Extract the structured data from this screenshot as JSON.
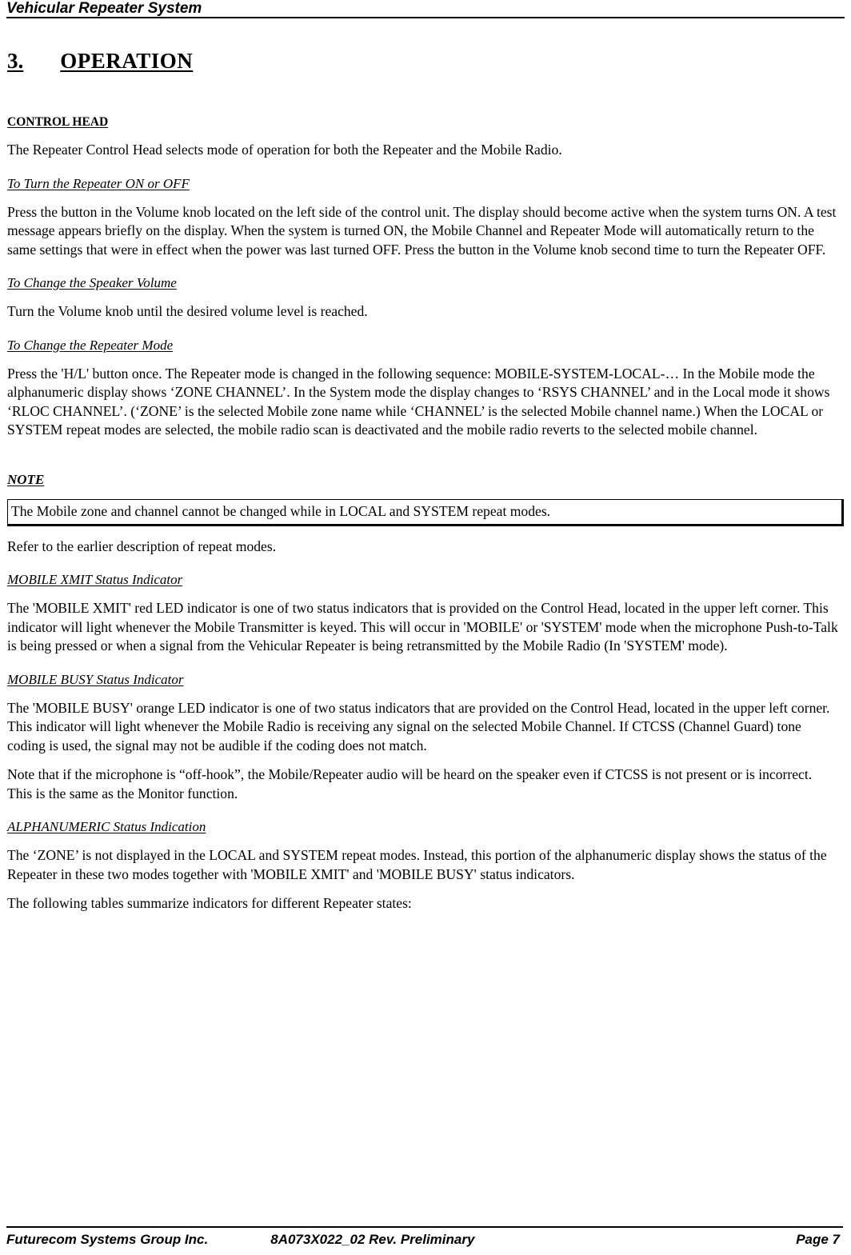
{
  "header": {
    "title": "Vehicular Repeater System"
  },
  "section": {
    "number": "3.",
    "title": "OPERATION"
  },
  "control_head": {
    "heading": "CONTROL HEAD",
    "intro": "The Repeater Control Head selects mode of operation for both the Repeater and the Mobile Radio.",
    "turn_on_off_heading": "To Turn the Repeater ON or OFF",
    "turn_on_off_body": "Press the button in the Volume knob located on the left side of the control unit. The display should become active when the system turns ON. A test message appears briefly on the display. When the system is turned ON, the Mobile Channel and Repeater Mode will automatically return to the same settings that were in effect when the power was last turned OFF. Press the button in the Volume knob second time to turn the Repeater OFF.",
    "speaker_volume_heading": "To Change the Speaker Volume",
    "speaker_volume_body": "Turn the Volume knob until the desired volume level is reached.",
    "repeater_mode_heading": "To Change the Repeater Mode",
    "repeater_mode_body": "Press the 'H/L' button once. The Repeater mode is changed in the following sequence: MOBILE-SYSTEM-LOCAL-… In the Mobile mode the alphanumeric display shows ‘ZONE CHANNEL’. In the System mode the display changes to ‘RSYS CHANNEL’ and in the Local mode it shows ‘RLOC CHANNEL’. (‘ZONE’ is the selected Mobile zone name while ‘CHANNEL’ is the selected Mobile channel name.) When the LOCAL or SYSTEM repeat modes are selected, the mobile radio scan is deactivated and the mobile radio reverts to the selected mobile channel."
  },
  "note": {
    "heading": "NOTE",
    "box_text": "The Mobile zone and channel cannot be changed while in LOCAL and SYSTEM repeat modes.",
    "after_text": "Refer to the earlier description of repeat modes."
  },
  "mobile_xmit": {
    "heading": "MOBILE XMIT Status Indicator",
    "body": "The 'MOBILE XMIT' red LED indicator is one of two status indicators that is provided on the Control Head, located in the upper left corner. This indicator will light whenever the Mobile Transmitter is keyed. This will occur in 'MOBILE' or 'SYSTEM' mode when the microphone Push-to-Talk is being pressed or when a signal from the Vehicular Repeater is being retransmitted by the Mobile Radio (In 'SYSTEM' mode)."
  },
  "mobile_busy": {
    "heading": "MOBILE BUSY Status Indicator",
    "body": "The 'MOBILE BUSY' orange LED indicator is one of two status indicators that are provided on the Control Head, located in the upper left corner. This indicator will light whenever the Mobile Radio is receiving any signal on the selected Mobile Channel. If CTCSS (Channel Guard) tone coding is used, the signal may not be audible if the coding does not match.",
    "note_body": "Note that if the microphone is “off-hook”, the Mobile/Repeater audio will be heard on the speaker even if CTCSS is not present or is incorrect. This is the same as the Monitor function."
  },
  "alphanumeric": {
    "heading": "ALPHANUMERIC Status Indication",
    "body": "The ‘ZONE’ is not displayed in the LOCAL and SYSTEM repeat modes. Instead, this portion of the alphanumeric display shows the status of the Repeater in these two modes together with 'MOBILE XMIT' and  'MOBILE BUSY' status indicators.",
    "closing": "The following tables summarize indicators for different Repeater states:"
  },
  "footer": {
    "company": "Futurecom Systems Group Inc.",
    "document": "8A073X022_02 Rev. Preliminary",
    "page": "Page 7"
  },
  "colors": {
    "text": "#000000",
    "background": "#ffffff",
    "rule": "#000000"
  }
}
